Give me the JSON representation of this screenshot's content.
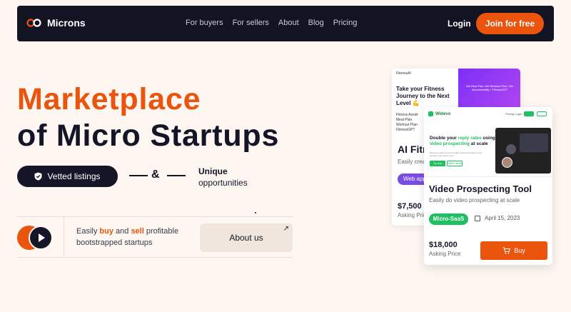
{
  "nav": {
    "brand": "Microns",
    "links": [
      "For buyers",
      "For sellers",
      "About",
      "Blog",
      "Pricing"
    ],
    "login": "Login",
    "join": "Join for free"
  },
  "hero": {
    "line1": "Marketplace",
    "line2": "of Micro Startups",
    "vetted": "Vetted listings",
    "amp": "&",
    "unique_1": "Unique",
    "unique_2": "opportunities",
    "tag_pre": "Easily ",
    "tag_buy": "buy",
    "tag_and": " and ",
    "tag_sell": "sell",
    "tag_post": " profitable",
    "tag_line2": "bootstrapped startups",
    "about": "About us",
    "about_arrow": "↗"
  },
  "back_card": {
    "brand": "FitnessAI",
    "headline": "Take your Fitness Journey to the Next Level 💪",
    "list": [
      "Fitness Assist",
      "Meal Plan",
      "Workout Plan",
      "FitnessGPT"
    ],
    "purple_text": "We Beat Plan, We Workout Plan, We Accountability + FitnessGPT",
    "title": "AI Fitn",
    "subtitle": "Easily creat",
    "badge": "Web app",
    "price": "$7,500",
    "asking": "Asking Pric"
  },
  "front_card": {
    "brand": "Widevo",
    "shot_navlinks": "Pricing   Login",
    "shot_head_pre": "Double your ",
    "shot_head_hl1": "reply rates",
    "shot_head_mid": " using ",
    "shot_head_hl2": "video prospecting",
    "shot_head_post": " at scale",
    "shot_small": "Record a video once and make it feel personal to every prospect you reach out to.",
    "shot_btn1": "Try now",
    "shot_btn2": "Watch demo",
    "title": "Video Prospecting Tool",
    "subtitle": "Easily do video prospecting at scale",
    "badge": "Micro-SaaS",
    "date": "April 15, 2023",
    "price": "$18,000",
    "asking": "Asking Price",
    "buy": "Buy"
  },
  "colors": {
    "accent": "#ea540d",
    "dark": "#141628",
    "green": "#1fbf62",
    "purple": "#7b4be6"
  }
}
